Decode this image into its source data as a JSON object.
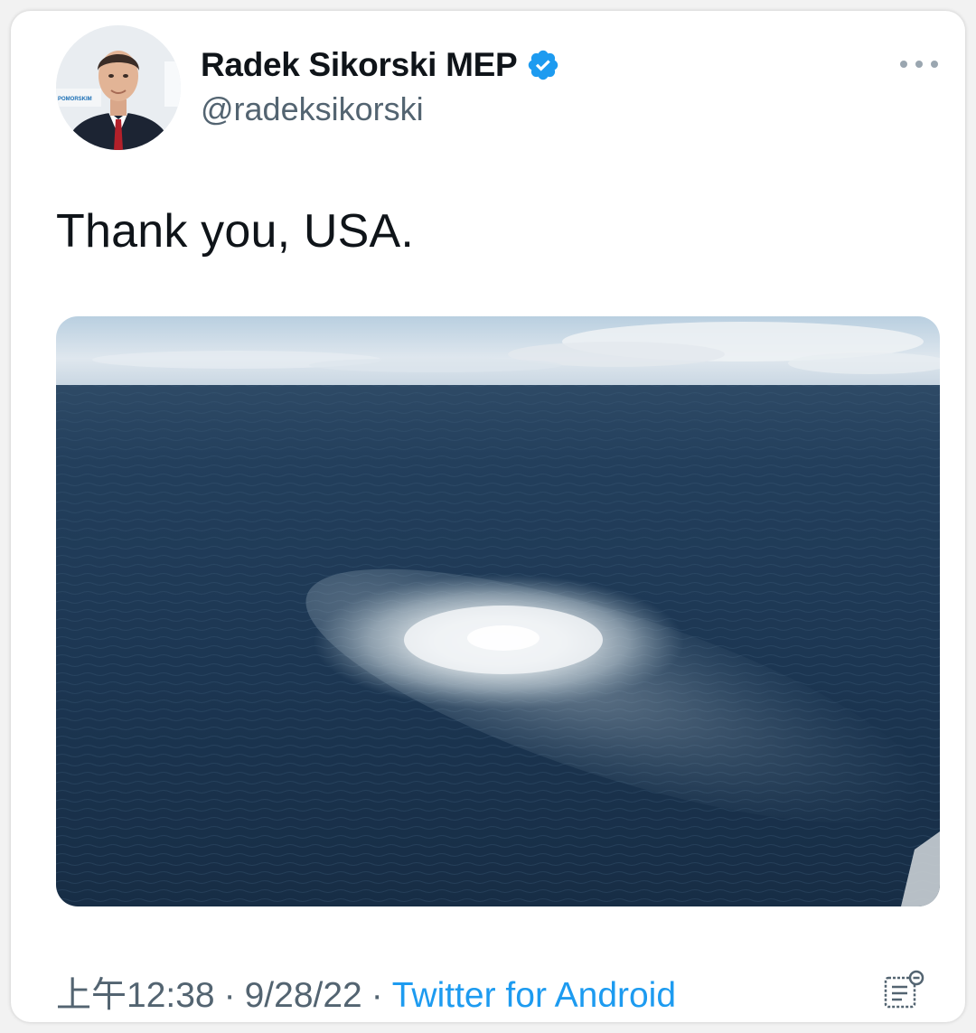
{
  "tweet": {
    "display_name": "Radek Sikorski MEP",
    "handle": "@radeksikorski",
    "verified": true,
    "text": "Thank you, USA.",
    "time": "上午12:38",
    "separator": "·",
    "date": "9/28/22",
    "source": "Twitter for Android"
  },
  "avatar": {
    "banner_text": "POMORSKIM"
  },
  "icons": {
    "verified": "verified-badge-icon",
    "more": "more-dots-icon",
    "analytics": "view-analytics-icon"
  },
  "colors": {
    "accent": "#1d9bf0",
    "text_primary": "#0f1419",
    "text_secondary": "#536471",
    "sea": "#1f3a57",
    "sky": "#dfe7ee"
  }
}
